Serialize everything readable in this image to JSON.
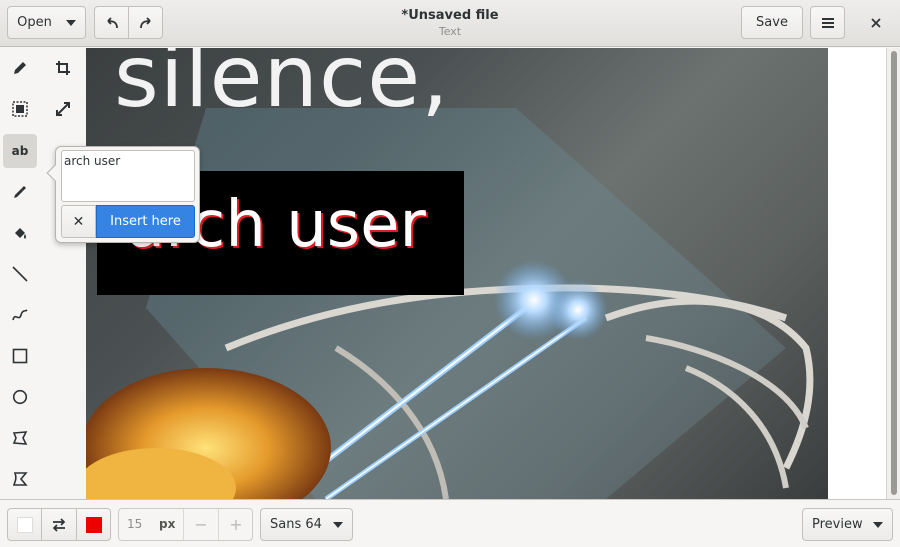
{
  "header": {
    "open_label": "Open",
    "title": "*Unsaved file",
    "subtitle": "Text",
    "save_label": "Save"
  },
  "tools": {
    "left_column": [
      "pencil-icon",
      "rect-select-icon",
      "text-icon",
      "color-picker-icon",
      "paint-bucket-icon",
      "line-icon",
      "curve-icon",
      "rectangle-icon",
      "circle-icon",
      "polygon-icon",
      "free-shape-icon"
    ],
    "right_column": [
      "crop-icon",
      "scale-icon"
    ],
    "text_tool_label": "ab",
    "active": "text-icon"
  },
  "canvas": {
    "image_caption_top": "silence,",
    "text_preview": "arch user",
    "text_color": "#e01b24",
    "text_bg": "#000000"
  },
  "popover": {
    "text_value": "arch user",
    "insert_label": "Insert here",
    "cancel_symbol": "✕"
  },
  "footer": {
    "main_color": "#ffffff",
    "secondary_color": "#ee0000",
    "size_value": "15",
    "size_unit": "px",
    "minus": "−",
    "plus": "+",
    "font_label": "Sans 64",
    "preview_label": "Preview"
  }
}
